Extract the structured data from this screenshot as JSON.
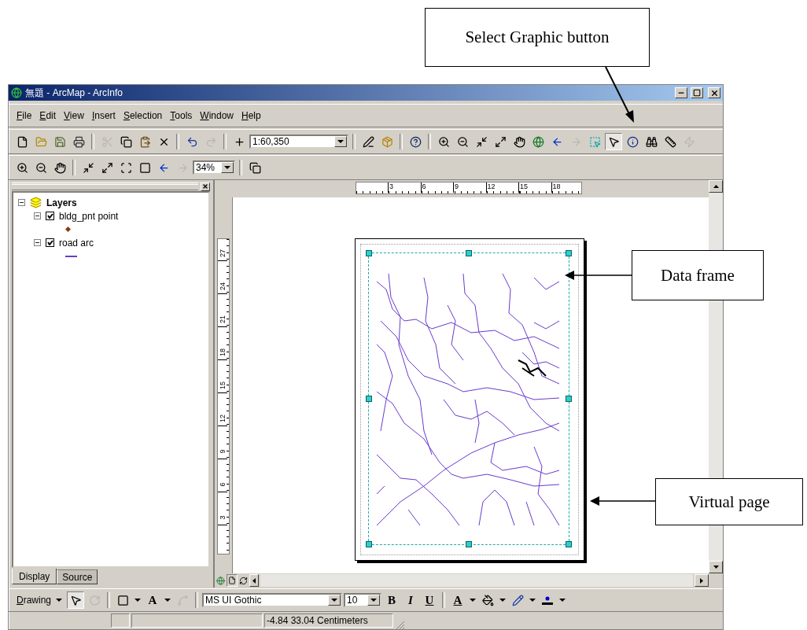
{
  "window": {
    "title": "無題 - ArcMap - ArcInfo"
  },
  "menu": [
    {
      "label": "File"
    },
    {
      "label": "Edit"
    },
    {
      "label": "View"
    },
    {
      "label": "Insert"
    },
    {
      "label": "Selection"
    },
    {
      "label": "Tools"
    },
    {
      "label": "Window"
    },
    {
      "label": "Help"
    }
  ],
  "standard_toolbar": [
    {
      "kind": "new",
      "disabled": false,
      "selected": false
    },
    {
      "kind": "open",
      "disabled": false,
      "selected": false
    },
    {
      "kind": "save",
      "disabled": false,
      "selected": false
    },
    {
      "kind": "print",
      "disabled": false,
      "selected": false
    },
    {
      "kind": "separator"
    },
    {
      "kind": "cut",
      "disabled": true,
      "selected": false
    },
    {
      "kind": "copy",
      "disabled": false,
      "selected": false
    },
    {
      "kind": "paste",
      "disabled": false,
      "selected": false
    },
    {
      "kind": "delete",
      "disabled": false,
      "selected": false
    },
    {
      "kind": "separator"
    },
    {
      "kind": "undo",
      "disabled": false,
      "selected": false
    },
    {
      "kind": "redo",
      "disabled": true,
      "selected": false
    },
    {
      "kind": "separator"
    },
    {
      "kind": "add_data",
      "disabled": false,
      "selected": false
    },
    {
      "kind": "scale",
      "value": "1:60,350"
    },
    {
      "kind": "separator"
    },
    {
      "kind": "editor",
      "disabled": false,
      "selected": false
    },
    {
      "kind": "toolbox",
      "disabled": false,
      "selected": false
    },
    {
      "kind": "separator"
    },
    {
      "kind": "whats_this",
      "disabled": false,
      "selected": false
    },
    {
      "kind": "separator"
    },
    {
      "kind": "zoom_in",
      "disabled": false,
      "selected": false
    },
    {
      "kind": "zoom_out",
      "disabled": false,
      "selected": false
    },
    {
      "kind": "fixed_zoom_in",
      "disabled": false,
      "selected": false
    },
    {
      "kind": "fixed_zoom_out",
      "disabled": false,
      "selected": false
    },
    {
      "kind": "pan",
      "disabled": false,
      "selected": false
    },
    {
      "kind": "full_extent",
      "disabled": false,
      "selected": false
    },
    {
      "kind": "back",
      "disabled": false,
      "selected": false
    },
    {
      "kind": "forward",
      "disabled": true,
      "selected": false
    },
    {
      "kind": "select_features",
      "disabled": false,
      "selected": false
    },
    {
      "kind": "select_elements",
      "disabled": false,
      "selected": true
    },
    {
      "kind": "identify",
      "disabled": false,
      "selected": false
    },
    {
      "kind": "find",
      "disabled": false,
      "selected": false
    },
    {
      "kind": "measure",
      "disabled": false,
      "selected": false
    },
    {
      "kind": "hyperlink",
      "disabled": true,
      "selected": false
    }
  ],
  "layout_toolbar": [
    {
      "kind": "zoom_in_page",
      "disabled": false,
      "selected": false
    },
    {
      "kind": "zoom_out_page",
      "disabled": false,
      "selected": false
    },
    {
      "kind": "pan_page",
      "disabled": false,
      "selected": false
    },
    {
      "kind": "separator"
    },
    {
      "kind": "fixed_zoom_in",
      "disabled": false,
      "selected": false
    },
    {
      "kind": "fixed_zoom_out",
      "disabled": false,
      "selected": false
    },
    {
      "kind": "zoom_whole",
      "disabled": false,
      "selected": false
    },
    {
      "kind": "zoom_100",
      "disabled": false,
      "selected": false
    },
    {
      "kind": "back",
      "disabled": false,
      "selected": false
    },
    {
      "kind": "forward",
      "disabled": true,
      "selected": false
    },
    {
      "kind": "zoom",
      "value": "34%"
    },
    {
      "kind": "separator"
    },
    {
      "kind": "draft",
      "disabled": false,
      "selected": false
    }
  ],
  "table_of_contents": {
    "name": "Layers",
    "expanded": true,
    "children": [
      {
        "name": "bldg_pnt point",
        "checked": true,
        "expanded": true,
        "kind": "point",
        "color": "#8b3a0f"
      },
      {
        "name": "road arc",
        "checked": true,
        "expanded": true,
        "kind": "line",
        "color": "#6a3acc"
      }
    ]
  },
  "toc_tabs": [
    {
      "label": "Display",
      "selected": true
    },
    {
      "label": "Source",
      "selected": false
    }
  ],
  "ruler": {
    "horizontal": [
      "3",
      "6",
      "9",
      "12",
      "15",
      "18"
    ],
    "vertical": [
      "3",
      "6",
      "9",
      "12",
      "15",
      "18",
      "21",
      "24",
      "27"
    ]
  },
  "drawing_toolbar": [
    {
      "kind": "menu",
      "label": "Drawing"
    },
    {
      "kind": "select",
      "disabled": false,
      "selected": true
    },
    {
      "kind": "rotate",
      "disabled": true,
      "selected": false
    },
    {
      "kind": "separator"
    },
    {
      "kind": "rectangle",
      "disabled": false,
      "selected": false,
      "dropdown": true
    },
    {
      "kind": "text",
      "label": "A",
      "disabled": false,
      "selected": false,
      "dropdown": true
    },
    {
      "kind": "vertices",
      "disabled": true,
      "selected": false
    },
    {
      "kind": "separator"
    },
    {
      "kind": "font",
      "value": "MS UI Gothic"
    },
    {
      "kind": "size",
      "value": "10"
    },
    {
      "kind": "bold",
      "label": "B",
      "disabled": false,
      "selected": false
    },
    {
      "kind": "italic",
      "label": "I",
      "disabled": false,
      "selected": false
    },
    {
      "kind": "underline",
      "label": "U",
      "disabled": false,
      "selected": false
    },
    {
      "kind": "separator"
    },
    {
      "kind": "font_color",
      "label": "A",
      "disabled": false,
      "selected": false,
      "dropdown": true
    },
    {
      "kind": "fill_color",
      "disabled": false,
      "selected": false,
      "dropdown": true
    },
    {
      "kind": "line_color",
      "disabled": false,
      "selected": false,
      "dropdown": true
    },
    {
      "kind": "marker_color",
      "disabled": false,
      "selected": false,
      "dropdown": true
    }
  ],
  "status_bar": {
    "coordinates": "-4.84  33.04 Centimeters"
  },
  "callouts": [
    {
      "text": "Select Graphic button"
    },
    {
      "text": "Data frame"
    },
    {
      "text": "Virtual page"
    }
  ]
}
